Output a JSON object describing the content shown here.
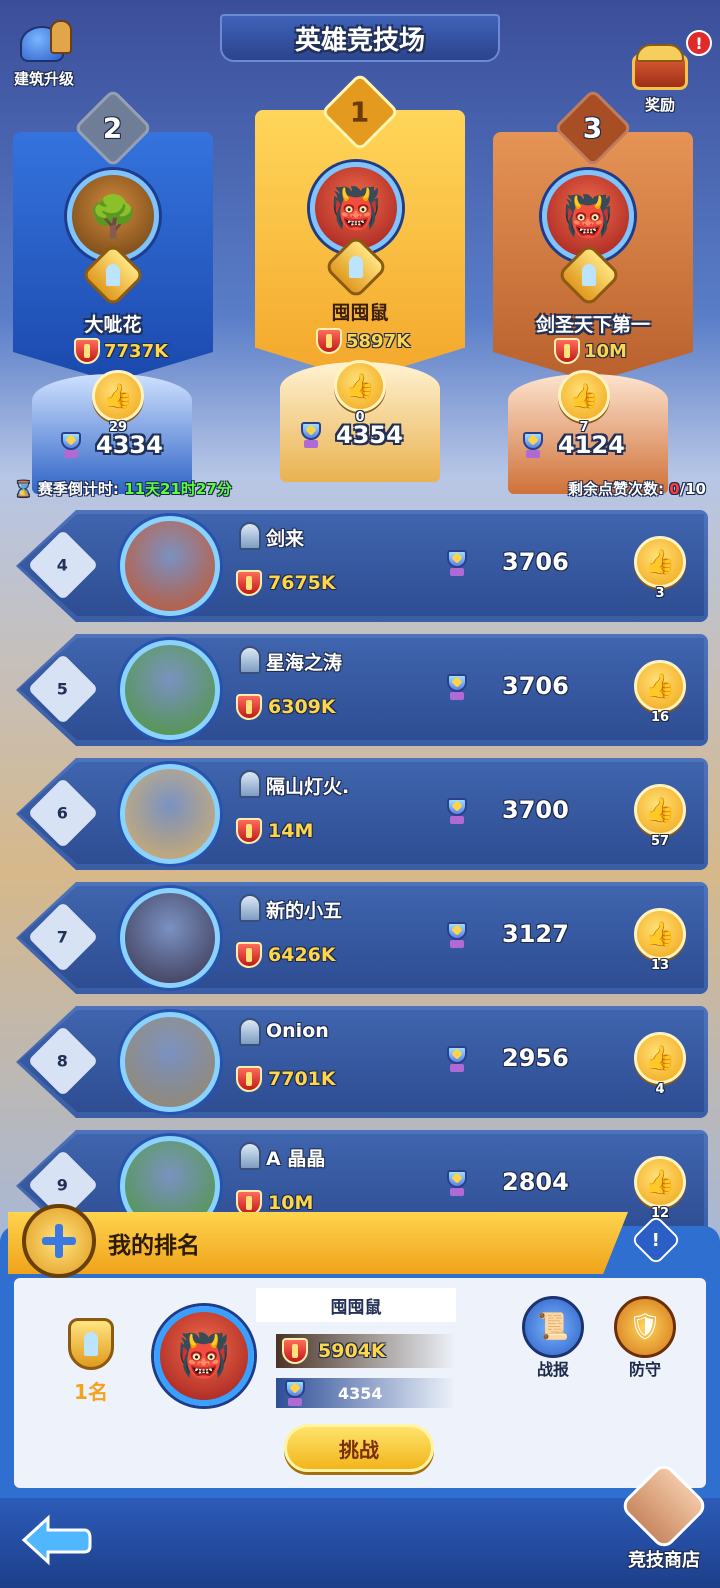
{
  "header": {
    "title": "英雄竞技场",
    "left_button": {
      "label": "建筑升级",
      "icon": "building-upgrade-icon"
    },
    "right_button": {
      "label": "奖励",
      "icon": "treasure-chest-icon",
      "badge": "!"
    }
  },
  "podium": [
    {
      "rank": "2",
      "name": "大呲花",
      "power": "7737K",
      "likes": "29",
      "score": "4334",
      "color": "#2f69d4"
    },
    {
      "rank": "1",
      "name": "囤囤鼠",
      "power": "5897K",
      "likes": "0",
      "score": "4354",
      "color": "#f7be3b"
    },
    {
      "rank": "3",
      "name": "剑圣天下第一",
      "power": "10M",
      "likes": "7",
      "score": "4124",
      "color": "#d97b3f"
    }
  ],
  "season": {
    "label": "赛季倒计时:",
    "countdown": "11天21时27分",
    "likes_label": "剩余点赞次数:",
    "likes_used": "0",
    "likes_total": "/10"
  },
  "list": [
    {
      "rank": "4",
      "name": "剑来",
      "power": "7675K",
      "score": "3706",
      "likes": "3",
      "avatar_color": "#c9552a"
    },
    {
      "rank": "5",
      "name": "星海之涛",
      "power": "6309K",
      "score": "3706",
      "likes": "16",
      "avatar_color": "#4f9a3c"
    },
    {
      "rank": "6",
      "name": "隔山灯火.",
      "power": "14M",
      "score": "3700",
      "likes": "57",
      "avatar_color": "#d8b26a"
    },
    {
      "rank": "7",
      "name": "新的小五",
      "power": "6426K",
      "score": "3127",
      "likes": "13",
      "avatar_color": "#3b3550"
    },
    {
      "rank": "8",
      "name": "Onion",
      "power": "7701K",
      "score": "2956",
      "likes": "4",
      "avatar_color": "#9a8a6a"
    },
    {
      "rank": "9",
      "name": "A 晶晶",
      "power": "10M",
      "score": "2804",
      "likes": "12",
      "avatar_color": "#4f9a3c"
    }
  ],
  "my_rank": {
    "title": "我的排名",
    "info_badge": "!",
    "rank_label": "1名",
    "name": "囤囤鼠",
    "power": "5904K",
    "score": "4354",
    "challenge_label": "挑战",
    "report_label": "战报",
    "defense_label": "防守"
  },
  "footer": {
    "back_icon": "back-arrow-icon",
    "shop_label": "竞技商店"
  }
}
